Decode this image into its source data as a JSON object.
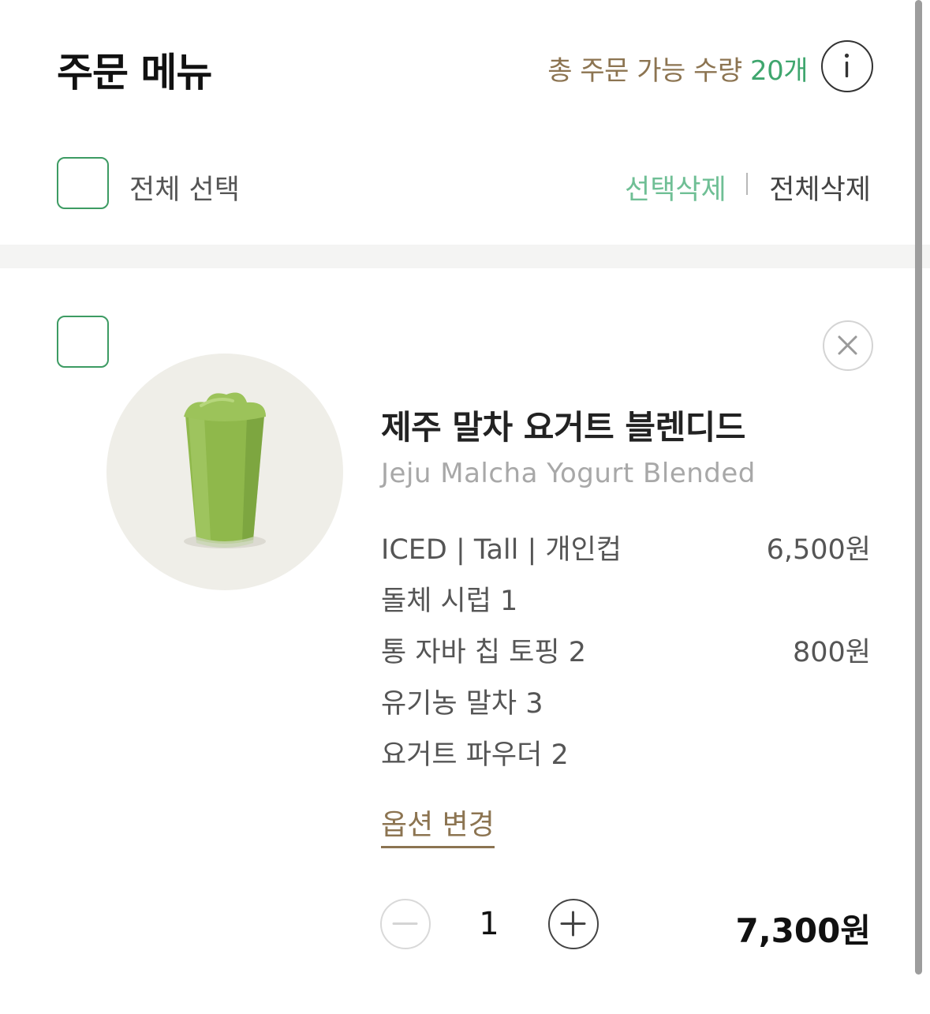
{
  "header": {
    "title": "주문 메뉴",
    "limit_label": "총 주문 가능 수량",
    "limit_count": "20개",
    "info_icon": "info-icon"
  },
  "selection": {
    "select_all_label": "전체 선택",
    "delete_selected_label": "선택삭제",
    "delete_all_label": "전체삭제"
  },
  "item": {
    "name_ko": "제주 말차 요거트 블렌디드",
    "name_en": "Jeju Malcha Yogurt Blended",
    "options": [
      {
        "label": "ICED | Tall | 개인컵",
        "price": "6,500원"
      },
      {
        "label": "돌체 시럽 1",
        "price": ""
      },
      {
        "label": "통 자바 칩 토핑 2",
        "price": "800원"
      },
      {
        "label": "유기농 말차 3",
        "price": ""
      },
      {
        "label": "요거트 파우더 2",
        "price": ""
      }
    ],
    "change_options_label": "옵션 변경",
    "quantity": "1",
    "total_price": "7,300원",
    "remove_icon": "close-icon"
  },
  "colors": {
    "accent_green": "#3fa66e",
    "light_green": "#6fbf95",
    "brown": "#8c7451",
    "checkbox_border": "#3d9b63"
  }
}
